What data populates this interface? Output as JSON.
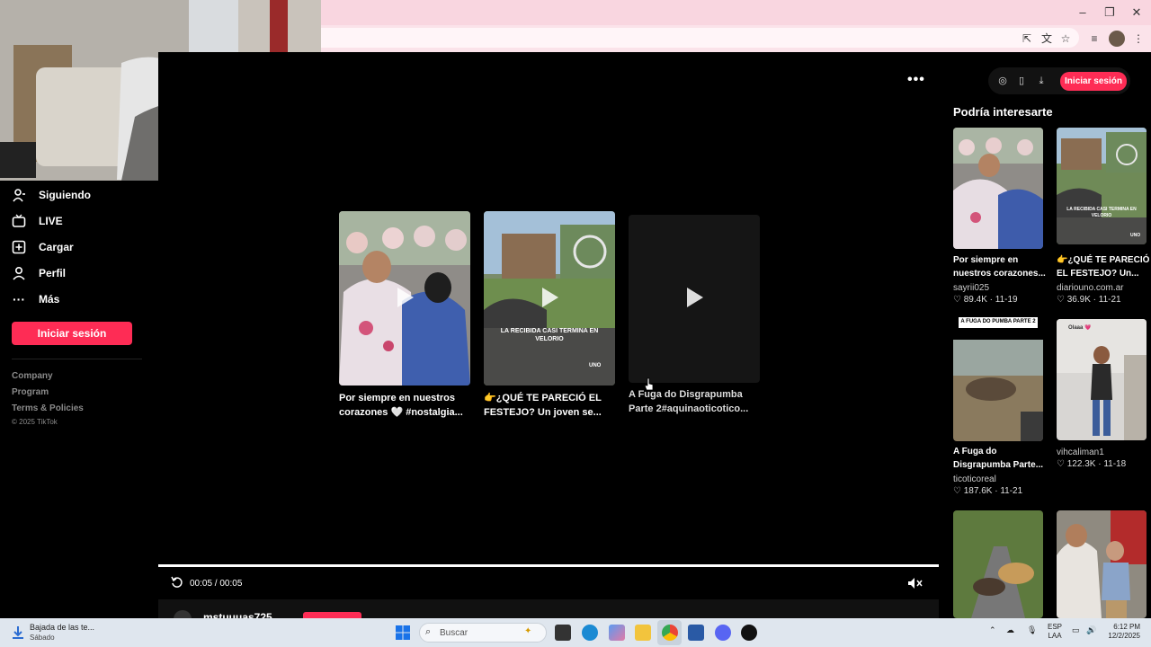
{
  "window_controls": {
    "minimize": "–",
    "maximize": "❐",
    "close": "✕"
  },
  "sidebar": {
    "items": [
      {
        "label": "Siguiendo",
        "icon": "person-follow-icon"
      },
      {
        "label": "LIVE",
        "icon": "live-icon"
      },
      {
        "label": "Cargar",
        "icon": "upload-icon"
      },
      {
        "label": "Perfil",
        "icon": "profile-icon"
      },
      {
        "label": "Más",
        "icon": "more-icon"
      }
    ],
    "login_label": "Iniciar sesión",
    "footer_links": [
      "Company",
      "Program",
      "Terms & Policies"
    ],
    "copyright": "© 2025 TikTok"
  },
  "player": {
    "related": [
      {
        "caption_l1": "Por siempre en nuestros",
        "caption_l2": "corazones 🤍 #nostalgia..."
      },
      {
        "caption_l1": "👉¿QUÉ TE PARECIÓ EL",
        "caption_l2": "FESTEJO? Un joven se...",
        "thumb_text": "LA RECIBIDA CASI TERMINA EN VELORIO",
        "watermark": "UNO"
      },
      {
        "caption_l1": "A Fuga do Disgrapumba",
        "caption_l2": "Parte 2#aquinaoticotico..."
      }
    ],
    "time": "00:05 / 00:05",
    "progress": 1.0,
    "author": "mstuuuas725"
  },
  "right_panel": {
    "login_label": "Iniciar sesión",
    "heading": "Podría interesarte",
    "items": [
      {
        "caption_l1": "Por siempre en",
        "caption_l2": "nuestros corazones...",
        "author": "sayrii025",
        "likes": "89.4K",
        "date": "11-19"
      },
      {
        "caption_l1": "👉¿QUÉ TE PARECIÓ",
        "caption_l2": "EL FESTEJO? Un...",
        "author": "diariouno.com.ar",
        "likes": "36.9K",
        "date": "11-21",
        "thumb_text": "LA RECIBIDA CASI TERMINA EN VELORIO",
        "watermark": "UNO"
      },
      {
        "caption_l1": "A Fuga do",
        "caption_l2": "Disgrapumba Parte...",
        "author": "ticoticoreal",
        "likes": "187.6K",
        "date": "11-21",
        "thumb_text": "A FUGA DO PUMBA PARTE 2"
      },
      {
        "caption_l1": "",
        "caption_l2": "",
        "author": "vihcaliman1",
        "likes": "122.3K",
        "date": "11-18",
        "thumb_text": "Olaaa 💗"
      }
    ]
  },
  "taskbar": {
    "notification_title": "Bajada de las te...",
    "notification_sub": "Sábado",
    "search_placeholder": "Buscar",
    "lang1": "ESP",
    "lang2": "LAA",
    "time": "6:12 PM",
    "date": "12/2/2025"
  }
}
